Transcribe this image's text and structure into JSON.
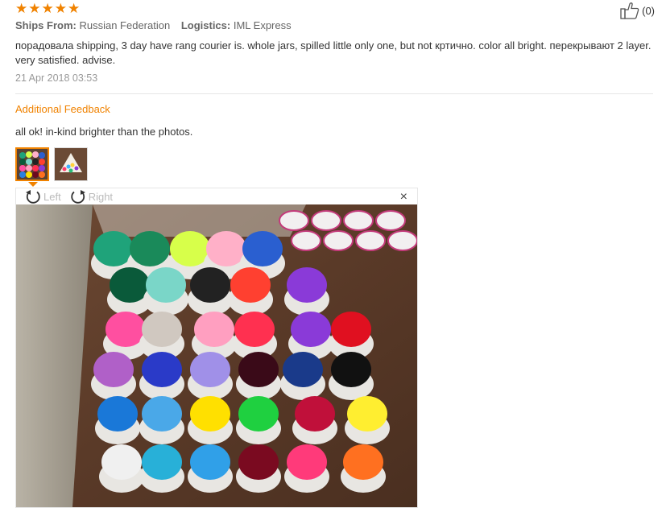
{
  "rating": {
    "stars": [
      "★",
      "★",
      "★",
      "★",
      "★"
    ],
    "color": "#f08200"
  },
  "helpful": {
    "icon": "thumbs-up-icon",
    "count": "(0)"
  },
  "meta": {
    "ships_from_label": "Ships From:",
    "ships_from_value": "Russian Federation",
    "logistics_label": "Logistics:",
    "logistics_value": "IML Express"
  },
  "review": {
    "text": "порадовала shipping, 3 day have rang courier is. whole jars, spilled little only one, but not кртично. color all bright. перекрывают 2 layer. very satisfied. advise.",
    "date": "21 Apr 2018 03:53"
  },
  "additional": {
    "title": "Additional Feedback",
    "text": "all ok! in-kind brighter than the photos."
  },
  "viewer": {
    "rotate_left": "Left",
    "rotate_right": "Right",
    "close": "×"
  }
}
